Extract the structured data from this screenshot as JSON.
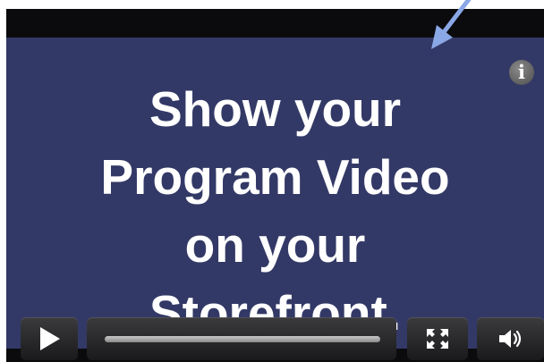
{
  "video": {
    "headline": [
      "Show your",
      "Program Video",
      "on your",
      "Storefront."
    ],
    "background_color": "#333966"
  },
  "controls": {
    "info_label": "i",
    "icons": {
      "info": "info-icon",
      "play": "play-icon",
      "fullscreen": "fullscreen-icon",
      "volume": "volume-icon",
      "pointer": "pointer-arrow-icon"
    }
  },
  "colors": {
    "arrow": "#8aa7e6",
    "text": "#ffffff",
    "controls": "#2a2a2c"
  }
}
